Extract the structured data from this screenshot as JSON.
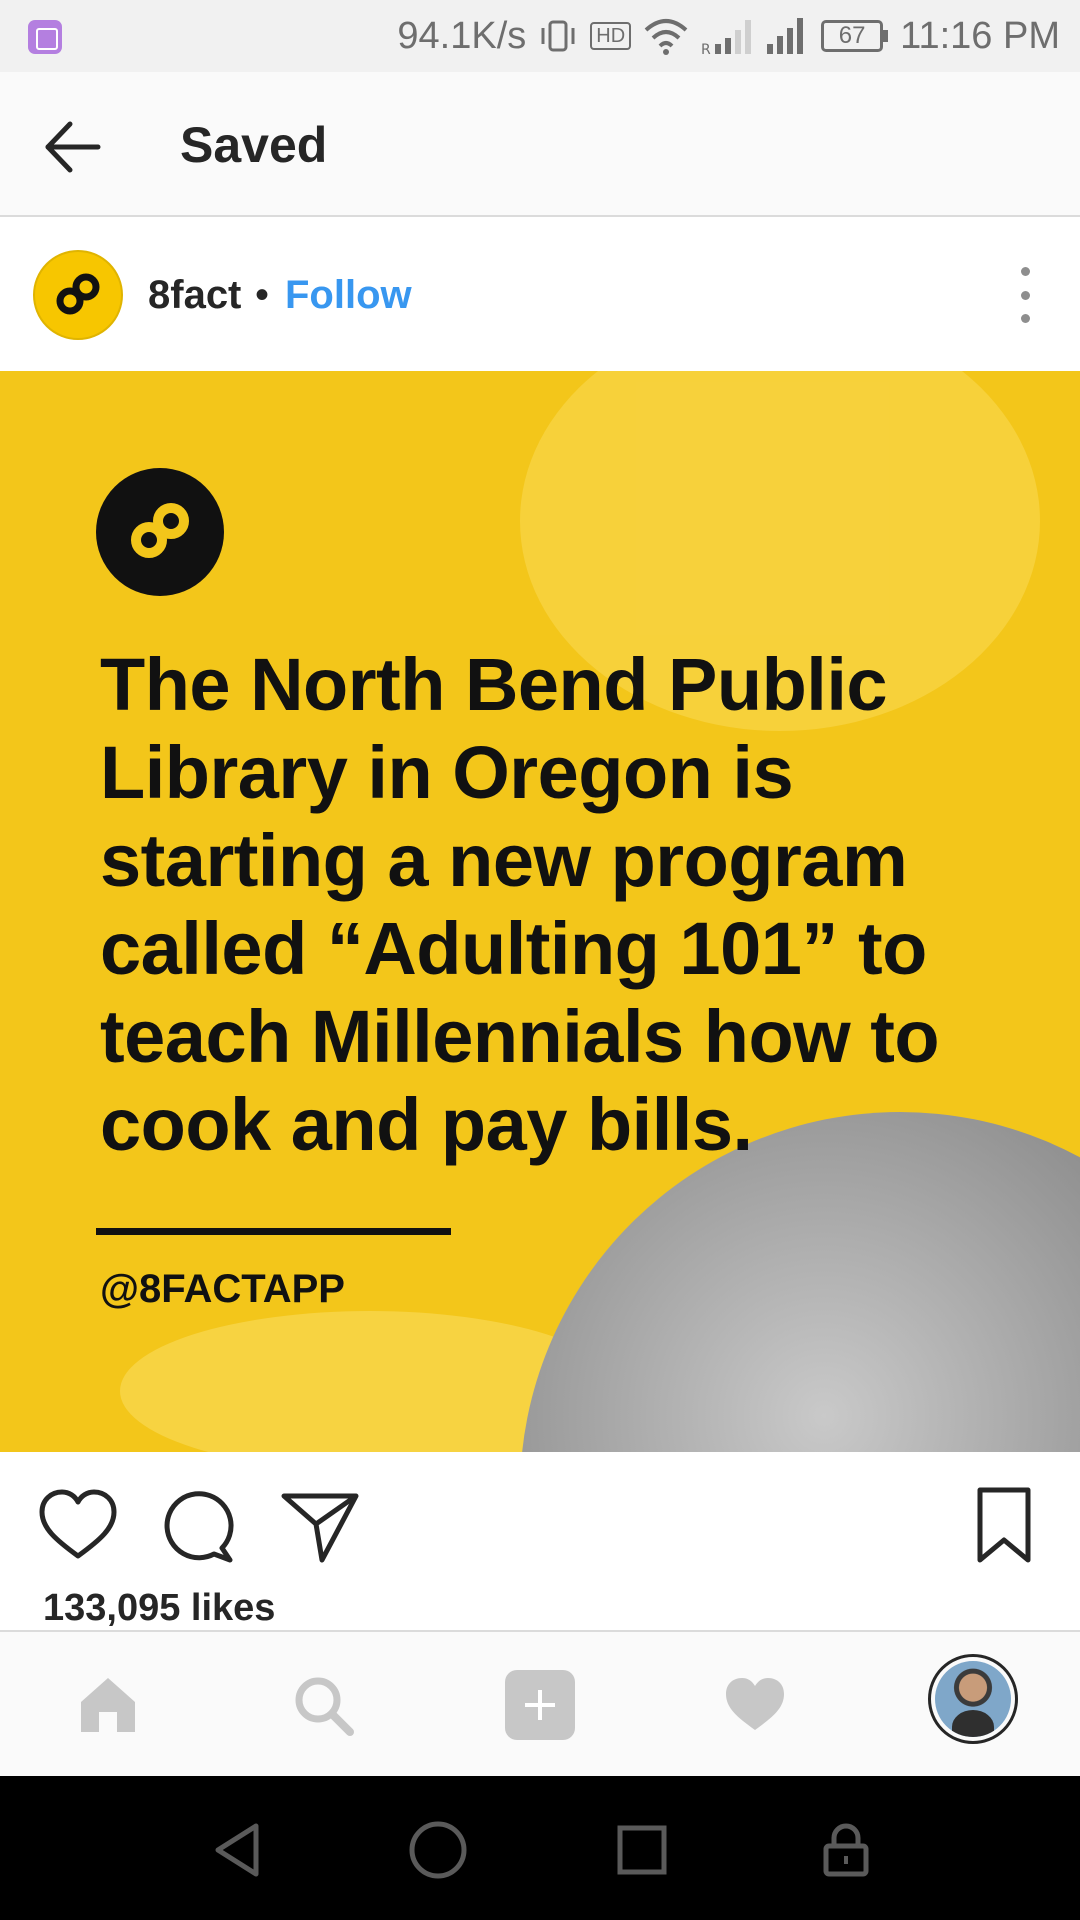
{
  "status_bar": {
    "speed": "94.1K/s",
    "hd": "HD",
    "battery": "67",
    "time": "11:16 PM",
    "icons": [
      "gallery-icon",
      "vibrate-icon",
      "wifi-icon",
      "signal-icon",
      "battery-icon"
    ]
  },
  "header": {
    "title": "Saved",
    "back_icon": "back-arrow-icon"
  },
  "post": {
    "username": "8fact",
    "separator": "•",
    "follow_label": "Follow",
    "more_icon": "more-vertical-icon",
    "image": {
      "headline": "The North Bend Public Library in Oregon is starting a new program called “Adulting 101” to teach Millennials how to cook and pay bills.",
      "handle": "@8FACTAPP",
      "colors": {
        "background": "#f3c61a",
        "text": "#111111"
      }
    },
    "actions": [
      "heart-icon",
      "comment-icon",
      "share-icon",
      "bookmark-icon"
    ],
    "likes": "133,095 likes"
  },
  "tabbar": {
    "items": [
      "home-icon",
      "search-icon",
      "add-icon",
      "activity-heart-icon",
      "profile-avatar"
    ]
  },
  "navbar": {
    "items": [
      "nav-back-icon",
      "nav-home-icon",
      "nav-recent-icon",
      "nav-lock-icon"
    ]
  },
  "colors": {
    "accent": "#3897f0",
    "text": "#262626",
    "divider": "#dbdbdb"
  }
}
